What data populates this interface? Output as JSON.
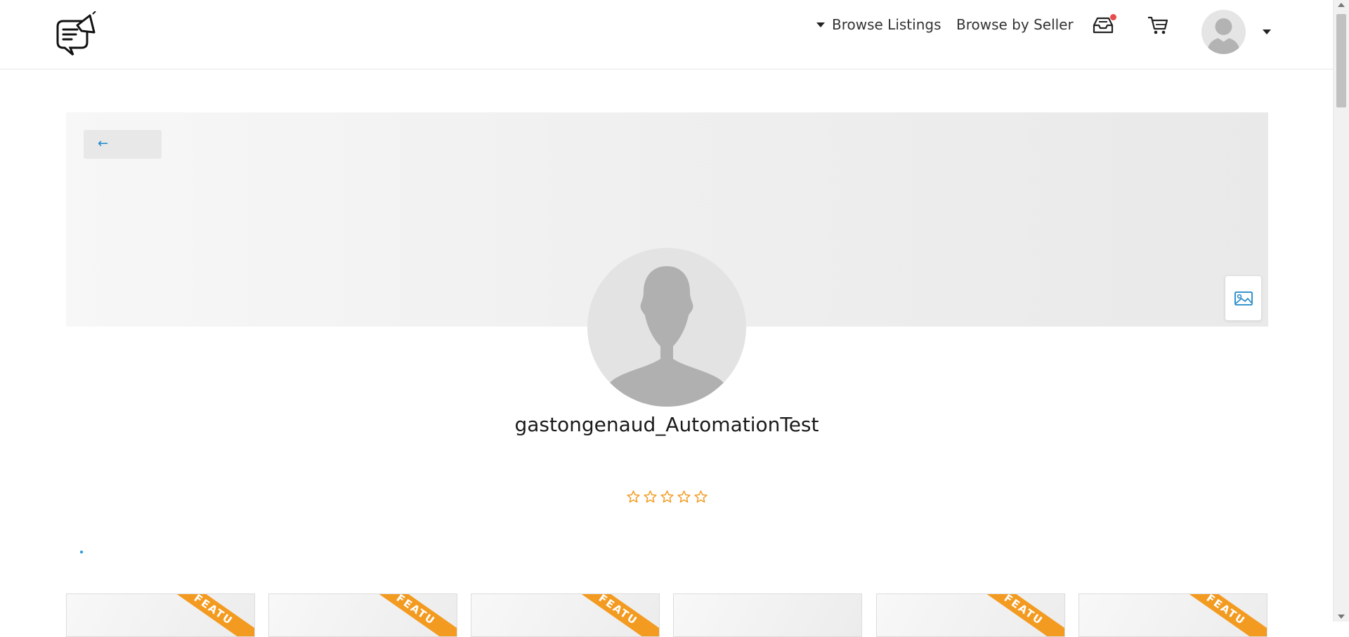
{
  "header": {
    "nav_browse_listings": "Browse Listings",
    "nav_browse_by_seller": "Browse by Seller",
    "notification_color": "#e84b4b"
  },
  "cover": {
    "back_label": "←"
  },
  "profile": {
    "username": "gastongenaud_AutomationTest",
    "rating": 0,
    "rating_max": 5,
    "star_color": "#f39b21"
  },
  "listings": {
    "ribbon_color": "#f39b21",
    "cards": [
      {
        "ribbon": "FEATU"
      },
      {
        "ribbon": "FEATU"
      },
      {
        "ribbon": "FEATU"
      },
      {
        "ribbon": ""
      },
      {
        "ribbon": "FEATU"
      },
      {
        "ribbon": "FEATU"
      }
    ]
  },
  "icons": {
    "logo": "megaphone-chat-logo",
    "inbox": "inbox-icon",
    "cart": "cart-icon",
    "cover_image": "image-icon",
    "avatar": "user-silhouette-icon"
  }
}
